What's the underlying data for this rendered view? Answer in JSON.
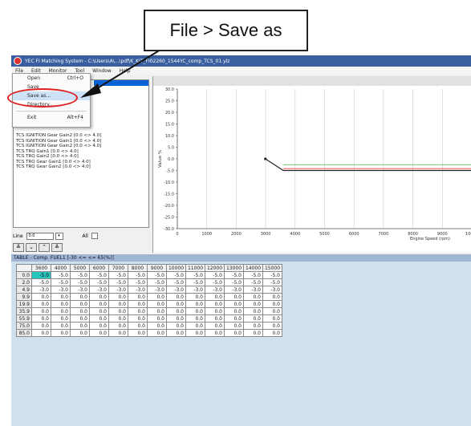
{
  "callout": {
    "text": "File > Save as"
  },
  "window": {
    "title": "YEC FI Matching System - C:\\Users\\A\\...\\pdf\\K_KIT_FI02260_1544YC_comp_TCS_01.ylz",
    "menus": [
      "File",
      "Edit",
      "Monitor",
      "Tool",
      "Window",
      "Help"
    ]
  },
  "file_menu": {
    "items": [
      {
        "label": "Open",
        "shortcut": "Ctrl+O"
      },
      {
        "label": "Save",
        "shortcut": ""
      },
      {
        "label": "Save as...",
        "shortcut": ""
      },
      {
        "label": "Directory...",
        "shortcut": ""
      },
      {
        "label": "Exit",
        "shortcut": "Alt+F4"
      }
    ]
  },
  "left_list": {
    "rows": [
      {
        "text": "",
        "selected": true
      },
      {
        "text": "",
        "selected": false
      },
      {
        "text": "",
        "selected": false
      },
      {
        "text": "",
        "selected": false
      },
      {
        "text": "TCS IGNITION Gear Gain2        [0.0 <> 4.0]",
        "selected": false
      },
      {
        "text": "TCS IGNITION Gear Gain1        [0.0 <> 4.0]",
        "selected": false
      },
      {
        "text": "TCS IGNITION Gear Gain2        [0.0 <> 4.0]",
        "selected": false
      },
      {
        "text": "TCS TRQ Gain1                  [0.0 <> 4.0]",
        "selected": false
      },
      {
        "text": "TCS TRQ Gain2                  [0.0 <> 4.0]",
        "selected": false
      },
      {
        "text": "TCS TRQ Gear Gain1             [0.0 <> 4.0]",
        "selected": false
      },
      {
        "text": "TCS TRQ Gear Gain2             [0.0 <> 4.0]",
        "selected": false
      }
    ],
    "line_label": "Line",
    "line_value": "0.0",
    "all_label": "All"
  },
  "chart": {
    "ylabel": "Value %",
    "xlabel": "Engine Speed (rpm)",
    "y_ticks": [
      "30.0",
      "25.0",
      "20.0",
      "15.0",
      "10.0",
      "5.0",
      "0.0",
      "-5.0",
      "-10.0",
      "-15.0",
      "-20.0",
      "-25.0",
      "-30.0"
    ],
    "x_ticks": [
      "0",
      "1000",
      "2000",
      "3000",
      "4000",
      "5000",
      "6000",
      "7000",
      "8000",
      "9000",
      "10000"
    ],
    "colors": {
      "green_line": "#4caf50",
      "red_line": "#e53935",
      "dark_line": "#222222"
    }
  },
  "chart_data": {
    "type": "line",
    "xlabel": "Engine Speed (rpm)",
    "ylabel": "Value %",
    "xlim": [
      0,
      10000
    ],
    "ylim": [
      -30,
      30
    ],
    "grid": true,
    "series": [
      {
        "name": "",
        "x": [
          2990,
          3600,
          10000
        ],
        "y": [
          0,
          -5,
          -5
        ]
      },
      {
        "name": "",
        "x": [
          3600,
          10000
        ],
        "y": [
          -4.2,
          -4.2
        ]
      },
      {
        "name": "",
        "x": [
          3600,
          10000
        ],
        "y": [
          -2.5,
          -2.5
        ]
      }
    ]
  },
  "table": {
    "title": "TABLE - Comp. FUEL1        [-30 <= <= 65(%)]",
    "columns": [
      "3600",
      "4000",
      "5000",
      "6000",
      "7000",
      "8000",
      "9000",
      "10000",
      "11000",
      "12000",
      "13000",
      "14000",
      "15000"
    ],
    "rows": [
      {
        "head": "0.0",
        "cells": [
          "-5.0",
          "-5.0",
          "-5.0",
          "-5.0",
          "-5.0",
          "-5.0",
          "-5.0",
          "-5.0",
          "-5.0",
          "-5.0",
          "-5.0",
          "-5.0",
          "-5.0"
        ]
      },
      {
        "head": "2.0",
        "cells": [
          "-5.0",
          "-5.0",
          "-5.0",
          "-5.0",
          "-5.0",
          "-5.0",
          "-5.0",
          "-5.0",
          "-5.0",
          "-5.0",
          "-5.0",
          "-5.0",
          "-5.0"
        ]
      },
      {
        "head": "4.9",
        "cells": [
          "-3.0",
          "-3.0",
          "-3.0",
          "-3.0",
          "-3.0",
          "-3.0",
          "-3.0",
          "-3.0",
          "-3.0",
          "-3.0",
          "-3.0",
          "-3.0",
          "-3.0"
        ]
      },
      {
        "head": "9.9",
        "cells": [
          "0.0",
          "0.0",
          "0.0",
          "0.0",
          "0.0",
          "0.0",
          "0.0",
          "0.0",
          "0.0",
          "0.0",
          "0.0",
          "0.0",
          "0.0"
        ]
      },
      {
        "head": "19.9",
        "cells": [
          "0.0",
          "0.0",
          "0.0",
          "0.0",
          "0.0",
          "0.0",
          "0.0",
          "0.0",
          "0.0",
          "0.0",
          "0.0",
          "0.0",
          "0.0"
        ]
      },
      {
        "head": "35.9",
        "cells": [
          "0.0",
          "0.0",
          "0.0",
          "0.0",
          "0.0",
          "0.0",
          "0.0",
          "0.0",
          "0.0",
          "0.0",
          "0.0",
          "0.0",
          "0.0"
        ]
      },
      {
        "head": "55.9",
        "cells": [
          "0.0",
          "0.0",
          "0.0",
          "0.0",
          "0.0",
          "0.0",
          "0.0",
          "0.0",
          "0.0",
          "0.0",
          "0.0",
          "0.0",
          "0.0"
        ]
      },
      {
        "head": "75.0",
        "cells": [
          "0.0",
          "0.0",
          "0.0",
          "0.0",
          "0.0",
          "0.0",
          "0.0",
          "0.0",
          "0.0",
          "0.0",
          "0.0",
          "0.0",
          "0.0"
        ]
      },
      {
        "head": "85.0",
        "cells": [
          "0.0",
          "0.0",
          "0.0",
          "0.0",
          "0.0",
          "0.0",
          "0.0",
          "0.0",
          "0.0",
          "0.0",
          "0.0",
          "0.0",
          "0.0"
        ]
      }
    ]
  }
}
